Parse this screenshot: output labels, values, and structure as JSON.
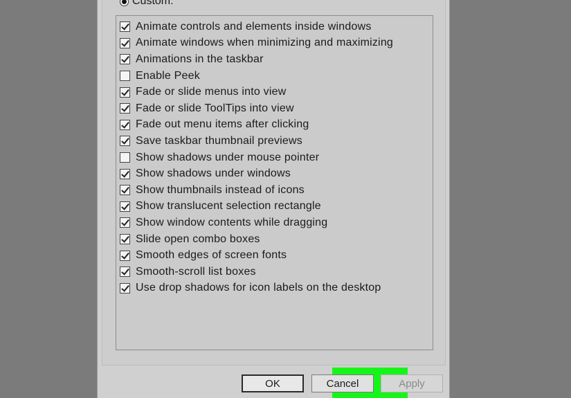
{
  "custom_radio": {
    "label": "Custom:",
    "selected": true
  },
  "options": [
    {
      "label": "Animate controls and elements inside windows",
      "checked": true
    },
    {
      "label": "Animate windows when minimizing and maximizing",
      "checked": true
    },
    {
      "label": "Animations in the taskbar",
      "checked": true
    },
    {
      "label": "Enable Peek",
      "checked": false
    },
    {
      "label": "Fade or slide menus into view",
      "checked": true
    },
    {
      "label": "Fade or slide ToolTips into view",
      "checked": true
    },
    {
      "label": "Fade out menu items after clicking",
      "checked": true
    },
    {
      "label": "Save taskbar thumbnail previews",
      "checked": true
    },
    {
      "label": "Show shadows under mouse pointer",
      "checked": false
    },
    {
      "label": "Show shadows under windows",
      "checked": true
    },
    {
      "label": "Show thumbnails instead of icons",
      "checked": true
    },
    {
      "label": "Show translucent selection rectangle",
      "checked": true
    },
    {
      "label": "Show window contents while dragging",
      "checked": true
    },
    {
      "label": "Slide open combo boxes",
      "checked": true
    },
    {
      "label": "Smooth edges of screen fonts",
      "checked": true
    },
    {
      "label": "Smooth-scroll list boxes",
      "checked": true
    },
    {
      "label": "Use drop shadows for icon labels on the desktop",
      "checked": true
    }
  ],
  "buttons": {
    "ok": "OK",
    "cancel": "Cancel",
    "apply": "Apply",
    "apply_enabled": false
  },
  "colors": {
    "highlight": "#16f51a",
    "backdrop": "#7b7b7b",
    "dialog": "#d0d0d0"
  }
}
